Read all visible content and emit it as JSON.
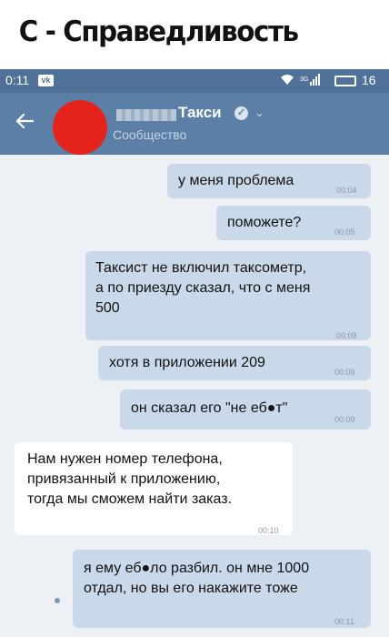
{
  "caption": "С - Справедливость",
  "status_bar": {
    "time": "0:11",
    "notification_icon": "vk-icon",
    "battery_level": "16"
  },
  "header": {
    "back_icon": "arrow-left-icon",
    "title": "Такси",
    "subtitle": "Сообщество",
    "avatar_color": "#e4241c"
  },
  "messages": [
    {
      "direction": "out",
      "text": "у меня проблема",
      "time": "00:04"
    },
    {
      "direction": "out",
      "text": "поможете?",
      "time": "00:05"
    },
    {
      "direction": "out",
      "text": "Таксист не включил таксометр,\nа по приезду сказал, что с меня\n500",
      "time": "00:09"
    },
    {
      "direction": "out",
      "text": "хотя в приложении 209",
      "time": "00:09"
    },
    {
      "direction": "out",
      "text": "он сказал его \"не еб●т\"",
      "time": "00:09"
    },
    {
      "direction": "in",
      "text": "Нам нужен номер телефона,\nпривязанный к приложению,\nтогда мы сможем найти заказ.",
      "time": "00:10"
    },
    {
      "direction": "out",
      "text": "я ему еб●ло разбил. он мне 1000\nотдал, но вы его накажите тоже",
      "time": "00:11"
    }
  ],
  "colors": {
    "status_bar": "#507299",
    "header": "#5b7fa6",
    "chat_background": "#edf0f4",
    "outgoing_bubble": "#cad9ea",
    "incoming_bubble": "#ffffff"
  }
}
